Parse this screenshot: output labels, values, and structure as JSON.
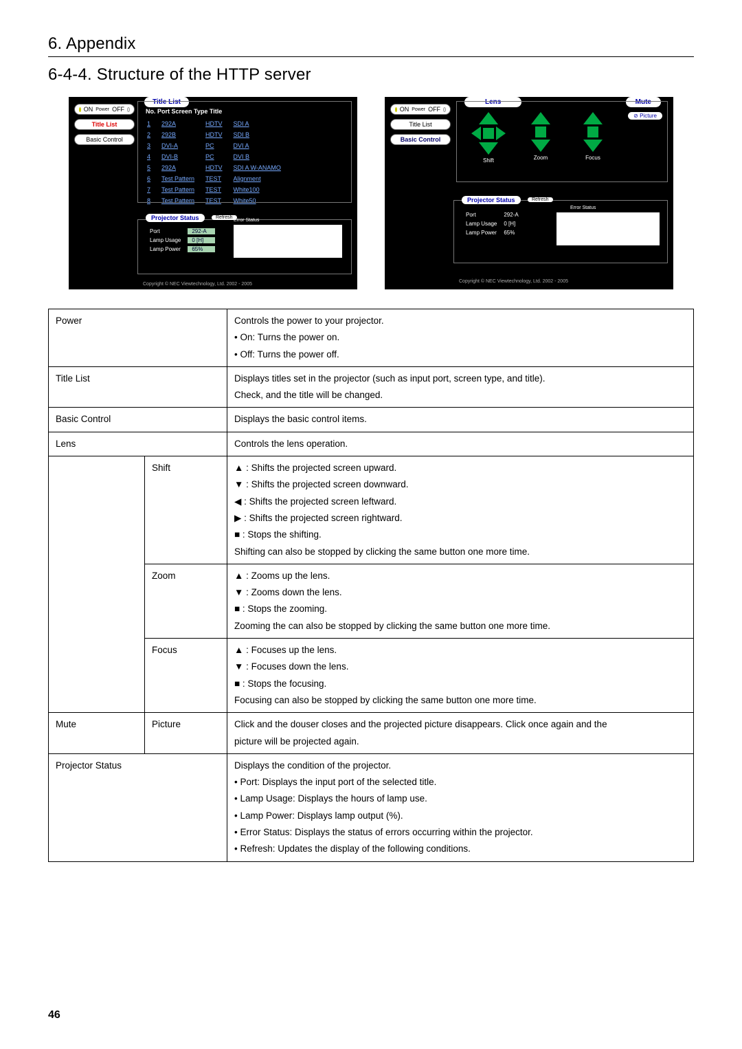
{
  "chapter": "6. Appendix",
  "section": "6-4-4. Structure of the HTTP server",
  "page_number": "46",
  "fig1": {
    "title_list_badge": "Title List",
    "sidebar": {
      "on": "ON",
      "power": "Power",
      "off": "OFF",
      "title_list": "Title List",
      "basic_control": "Basic Control"
    },
    "header": "No. Port        Screen Type Title",
    "rows": [
      {
        "n": "1",
        "port": "292A",
        "type": "HDTV",
        "title": "SDI A"
      },
      {
        "n": "2",
        "port": "292B",
        "type": "HDTV",
        "title": "SDI B"
      },
      {
        "n": "3",
        "port": "DVI-A",
        "type": "PC",
        "title": "DVI A"
      },
      {
        "n": "4",
        "port": "DVI-B",
        "type": "PC",
        "title": "DVI B"
      },
      {
        "n": "5",
        "port": "292A",
        "type": "HDTV",
        "title": "SDI A W-ANAMO"
      },
      {
        "n": "6",
        "port": "Test Pattern",
        "type": "TEST",
        "title": "Alignment"
      },
      {
        "n": "7",
        "port": "Test Pattern",
        "type": "TEST",
        "title": "White100"
      },
      {
        "n": "8",
        "port": "Test Pattern",
        "type": "TEST",
        "title": "White50"
      }
    ],
    "projector_status": "Projector Status",
    "refresh": "Refresh",
    "ps_port_label": "Port",
    "ps_port_val": "292-A",
    "ps_lamp_usage_label": "Lamp Usage",
    "ps_lamp_usage_val": "0 [H]",
    "ps_lamp_power_label": "Lamp Power",
    "ps_lamp_power_val": "65%",
    "err_label": "Error Status",
    "copyright": "Copyright © NEC Viewtechnology, Ltd. 2002 - 2005"
  },
  "fig2": {
    "sidebar": {
      "on": "ON",
      "power": "Power",
      "off": "OFF",
      "title_list": "Title List",
      "basic_control": "Basic Control"
    },
    "lens": "Lens",
    "mute": "Mute",
    "picture": "⊘ Picture",
    "labels": {
      "shift": "Shift",
      "zoom": "Zoom",
      "focus": "Focus"
    },
    "projector_status": "Projector Status",
    "refresh": "Refresh",
    "ps_port_label": "Port",
    "ps_port_val": "292-A",
    "ps_lamp_usage_label": "Lamp Usage",
    "ps_lamp_usage_val": "0 [H]",
    "ps_lamp_power_label": "Lamp Power",
    "ps_lamp_power_val": "65%",
    "err_label": "Error Status",
    "copyright": "Copyright © NEC Viewtechnology, Ltd. 2002 - 2005"
  },
  "table": {
    "power": {
      "name": "Power",
      "l1": "Controls the power to your projector.",
      "l2": "• On: Turns the power on.",
      "l3": "• Off: Turns the power off."
    },
    "title_list": {
      "name": "Title List",
      "l1": "Displays titles set in the projector (such as input port, screen type, and title).",
      "l2": "Check, and the title will be changed."
    },
    "basic_control": {
      "name": "Basic Control",
      "l1": "Displays the basic control items."
    },
    "lens": {
      "name": "Lens",
      "l1": "Controls the lens operation."
    },
    "shift": {
      "name": "Shift",
      "l1": "▲ : Shifts the projected screen upward.",
      "l2": "▼ : Shifts the projected screen downward.",
      "l3": "◀ : Shifts the projected screen leftward.",
      "l4": "▶ : Shifts the projected screen rightward.",
      "l5": "■ : Stops the shifting.",
      "l6": "Shifting can also be stopped by clicking the same button one more time."
    },
    "zoom": {
      "name": "Zoom",
      "l1": "▲ : Zooms up the lens.",
      "l2": "▼ : Zooms down the lens.",
      "l3": "■ : Stops the zooming.",
      "l4": "Zooming the can also be stopped by clicking the same button one more time."
    },
    "focus": {
      "name": "Focus",
      "l1": "▲ : Focuses up the lens.",
      "l2": "▼ : Focuses down the lens.",
      "l3": "■ : Stops the focusing.",
      "l4": "Focusing can also be stopped by clicking the same button one more time."
    },
    "mute": {
      "name": "Mute",
      "sub": "Picture",
      "l1": "Click and the douser closes and the projected picture disappears. Click once again and the",
      "l2": "picture will be projected again."
    },
    "projector_status": {
      "name": "Projector Status",
      "l1": "Displays the condition of the projector.",
      "l2": "• Port: Displays the input port of the selected title.",
      "l3": "• Lamp Usage: Displays the hours of lamp use.",
      "l4": "• Lamp Power: Displays lamp output (%).",
      "l5": "• Error Status: Displays the status of errors occurring within the projector.",
      "l6": "• Refresh: Updates the display of the following conditions."
    }
  }
}
